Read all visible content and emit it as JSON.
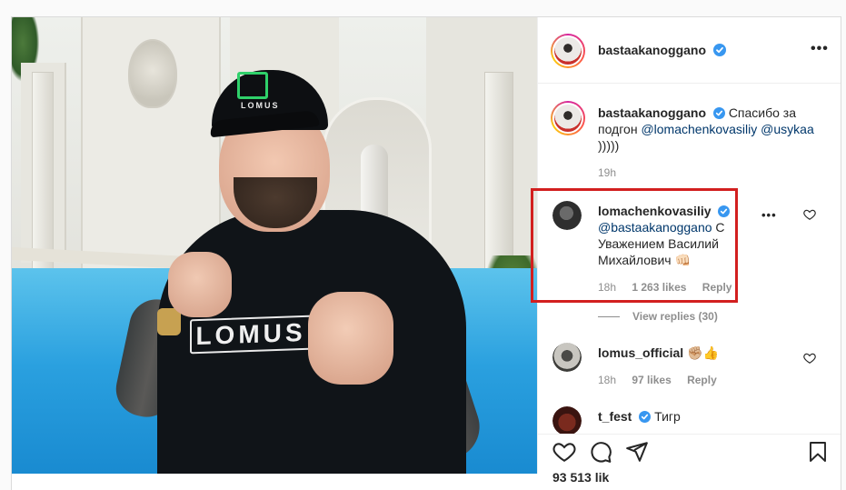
{
  "post": {
    "author": "bastaakanoggano",
    "more_label": "•••"
  },
  "photo": {
    "cap_text": "LOMUS",
    "shirt_text": "LOMUS"
  },
  "comments": [
    {
      "username": "bastaakanoggano",
      "text_prefix": "Спасибо за подгон ",
      "mention1": "@lomachenkovasiliy",
      "mention2": "@usykaa",
      "text_suffix": " )))))",
      "time": "19h"
    },
    {
      "username": "lomachenkovasiliy",
      "mention": "@bastaakanoggano",
      "text": " С Уважением Василий Михайлович 👊🏻",
      "time": "18h",
      "likes": "1 263 likes",
      "reply": "Reply",
      "view_replies": "View replies (30)"
    },
    {
      "username": "lomus_official",
      "text": "✊🏼👍",
      "time": "18h",
      "likes": "97 likes",
      "reply": "Reply"
    },
    {
      "username": "t_fest",
      "text": "Тигр"
    }
  ],
  "footer": {
    "likes_partial": "93 513 lik"
  },
  "colors": {
    "verified": "#3897f0",
    "mention": "#00376b",
    "highlight": "#d21f1f"
  }
}
